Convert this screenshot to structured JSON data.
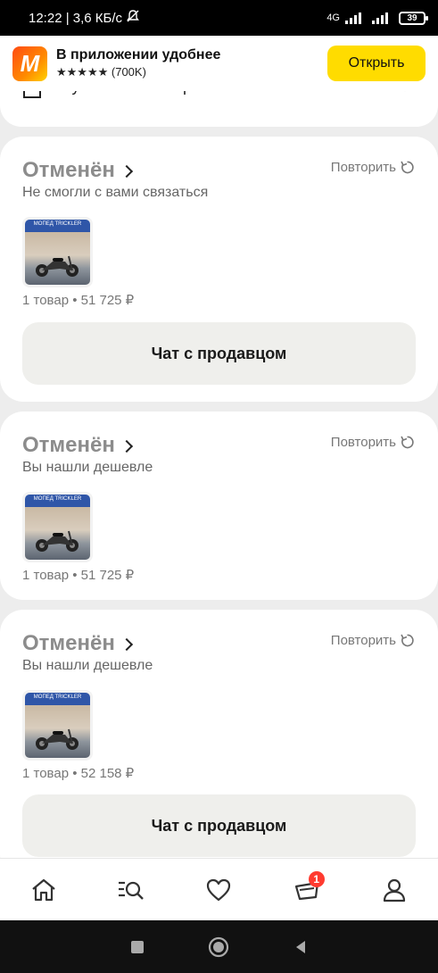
{
  "status_bar": {
    "time_speed": "12:22 | 3,6 КБ/с",
    "network": "4G",
    "battery": "39"
  },
  "app_banner": {
    "title": "В приложении удобнее",
    "rating": "★★★★★ (700K)",
    "open_label": "Открыть",
    "accent": "#ffdc00"
  },
  "prev_section": {
    "label": "Купленные товары"
  },
  "orders": [
    {
      "status": "Отменён",
      "reason": "Не смогли с вами связаться",
      "repeat_label": "Повторить",
      "summary": "1 товар • 51 725 ₽",
      "chat_label": "Чат с продавцом"
    },
    {
      "status": "Отменён",
      "reason": "Вы нашли дешевле",
      "repeat_label": "Повторить",
      "summary": "1 товар • 51 725 ₽"
    },
    {
      "status": "Отменён",
      "reason": "Вы нашли дешевле",
      "repeat_label": "Повторить",
      "summary": "1 товар • 52 158 ₽",
      "chat_label": "Чат с продавцом"
    }
  ],
  "thumb_caption": "МОПЕД TRICKLER",
  "bottom_nav": {
    "items": [
      "home-icon",
      "catalog-search-icon",
      "heart-icon",
      "cart-icon",
      "profile-icon"
    ],
    "cart_badge": "1"
  }
}
